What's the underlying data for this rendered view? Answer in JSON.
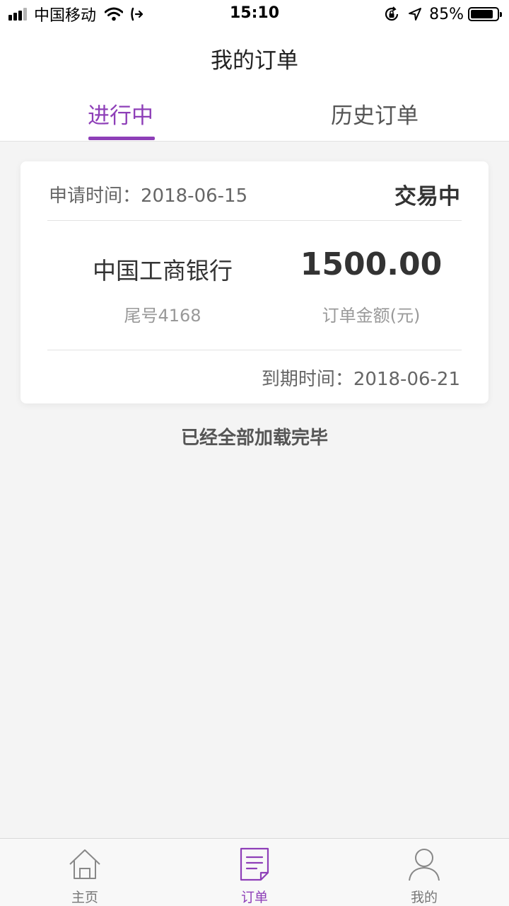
{
  "status_bar": {
    "carrier": "中国移动",
    "time": "15:10",
    "battery": "85%",
    "battery_level": 0.85
  },
  "nav": {
    "title": "我的订单"
  },
  "tabs": [
    {
      "label": "进行中",
      "active": true
    },
    {
      "label": "历史订单",
      "active": false
    }
  ],
  "order": {
    "apply_time_label": "申请时间：",
    "apply_time": "2018-06-15",
    "status": "交易中",
    "bank": "中国工商银行",
    "tail_no": "尾号4168",
    "amount": "1500.00",
    "amount_label": "订单金额(元)",
    "due_time_label": "到期时间：",
    "due_time": "2018-06-21"
  },
  "list_footer": "已经全部加载完毕",
  "colors": {
    "accent": "#8e3fb8",
    "background": "#f4f4f4"
  },
  "tabbar": [
    {
      "label": "主页",
      "icon": "home-icon",
      "active": false
    },
    {
      "label": "订单",
      "icon": "order-icon",
      "active": true
    },
    {
      "label": "我的",
      "icon": "profile-icon",
      "active": false
    }
  ]
}
